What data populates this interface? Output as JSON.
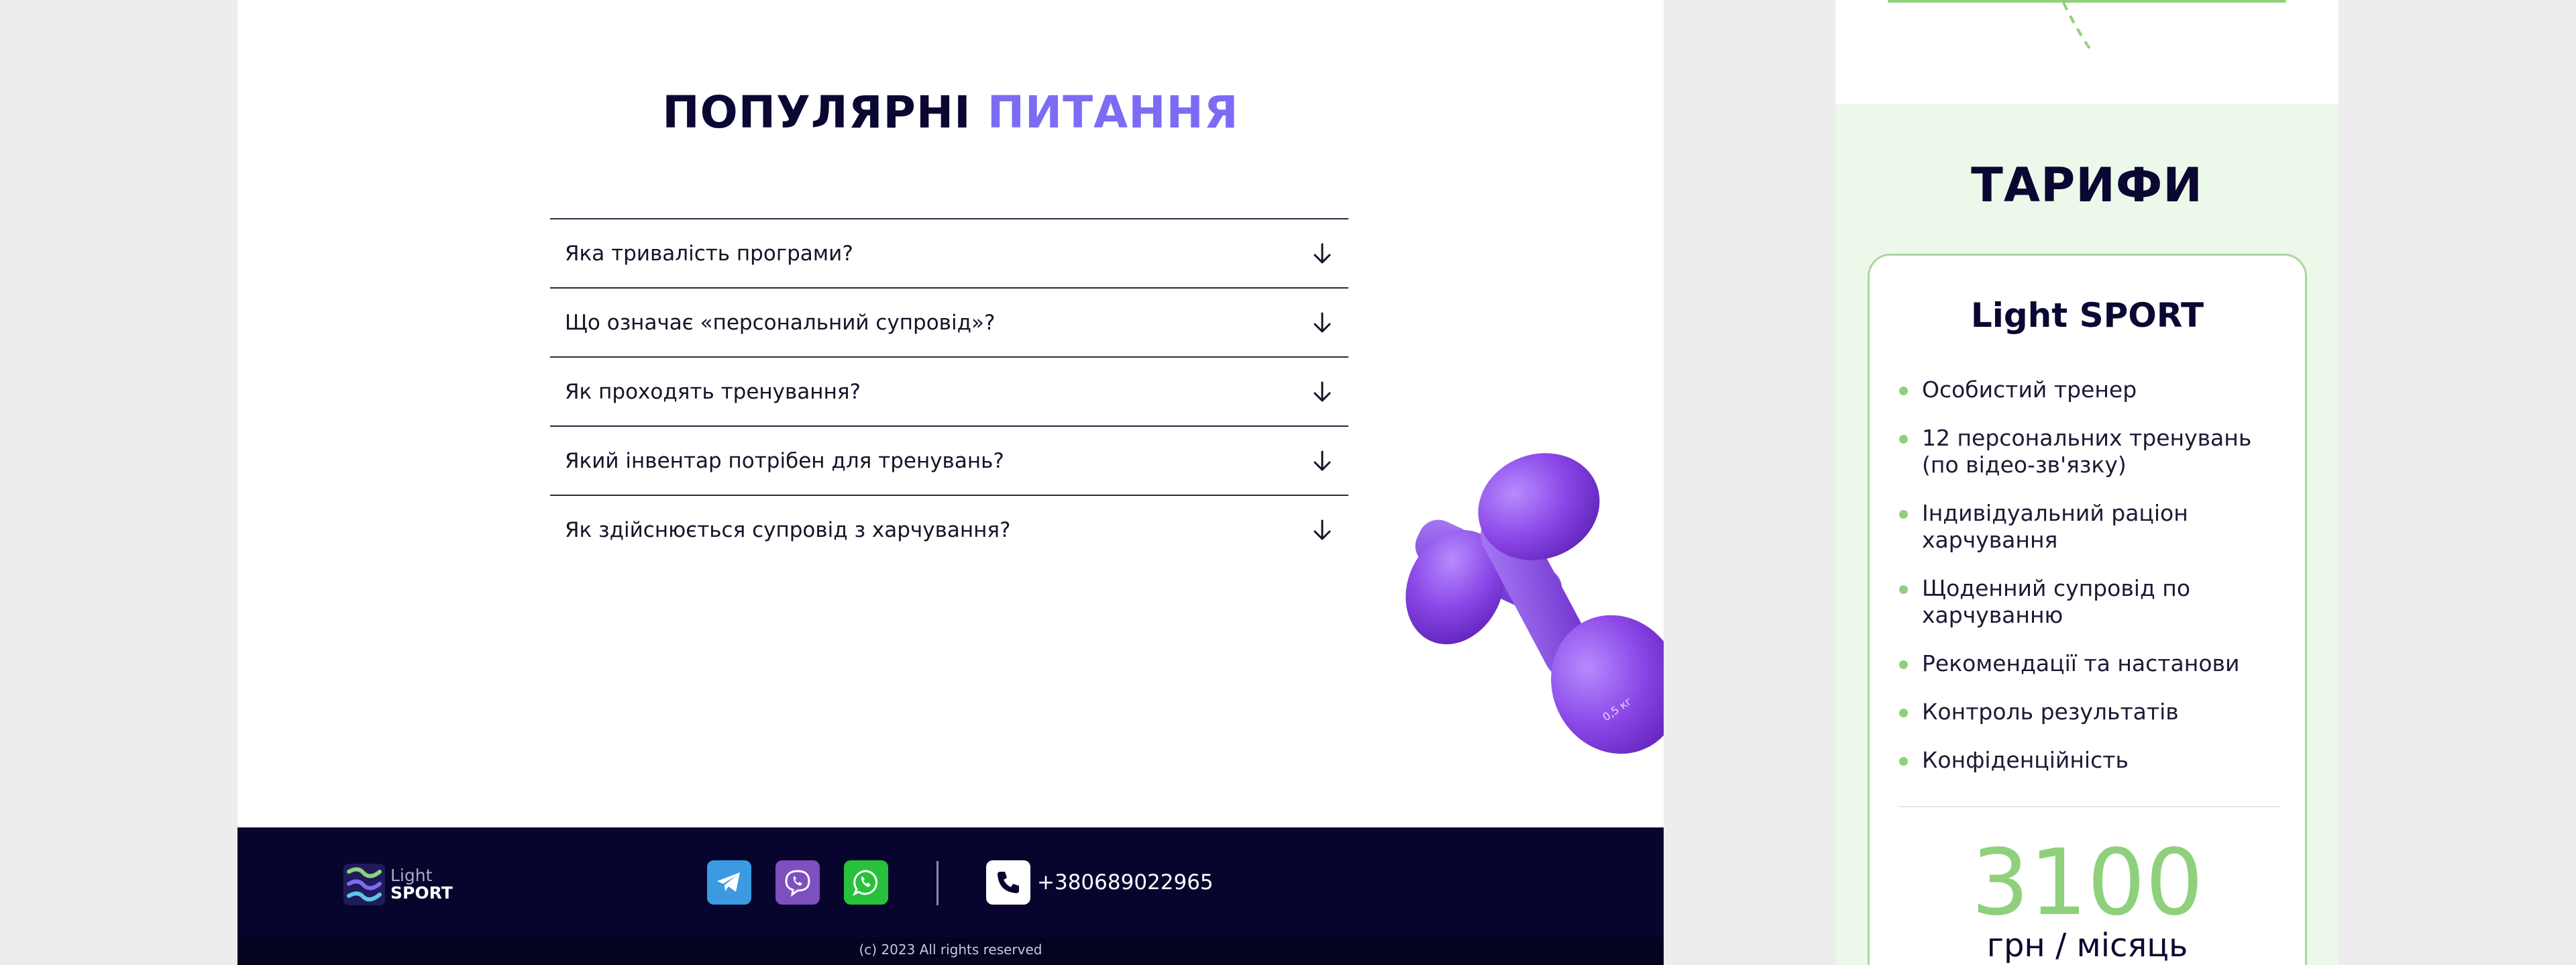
{
  "faq": {
    "title_main": "ПОПУЛЯРНІ",
    "title_accent": "ПИТАННЯ",
    "items": [
      {
        "question": "Яка тривалість програми?"
      },
      {
        "question": "Що означає «персональний супровід»?"
      },
      {
        "question": "Як проходять тренування?"
      },
      {
        "question": "Який інвентар потрібен для тренувань?"
      },
      {
        "question": "Як здійснюється супровід з харчування?"
      }
    ],
    "dumbbell_weight_label": "0,5 кг"
  },
  "footer": {
    "logo_light": "Light",
    "logo_sport": "SPORT",
    "social": [
      {
        "icon": "telegram-icon",
        "color": "#3b9ae1"
      },
      {
        "icon": "viber-icon",
        "color": "#7d4fbf"
      },
      {
        "icon": "whatsapp-icon",
        "color": "#27c13c"
      }
    ],
    "phone": "+380689022965",
    "copyright": "(c) 2023 All rights reserved"
  },
  "pricing": {
    "title": "ТАРИФИ",
    "plan": {
      "name": "Light SPORT",
      "features": [
        "Особистий тренер",
        "12 персональних тренувань (по відео-зв'язку)",
        "Індивідуальний раціон харчування",
        "Щоденний супровід по харчуванню",
        "Рекомендації та настанови",
        "Контроль результатів",
        "Конфіденційність"
      ],
      "price": "3100",
      "price_unit": "грн / місяць"
    }
  },
  "colors": {
    "accent_purple": "#7c6cf4",
    "accent_green": "#8fd07c",
    "dark_navy": "#07052e"
  }
}
